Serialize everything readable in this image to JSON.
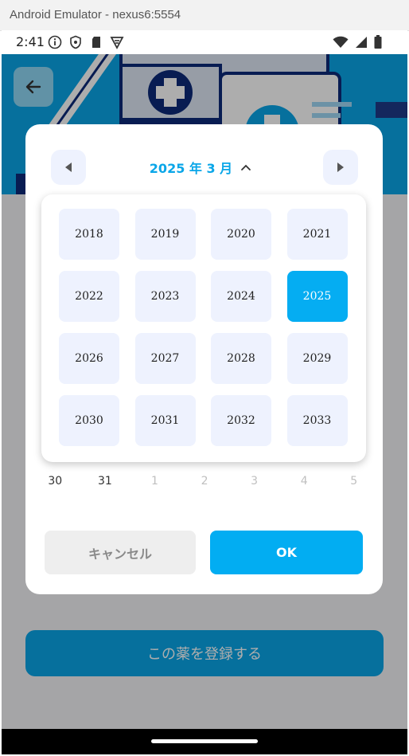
{
  "window": {
    "title": "Android Emulator - nexus6:5554"
  },
  "statusbar": {
    "time": "2:41",
    "left_icons": [
      "info-icon",
      "shield-icon",
      "sd-card-icon",
      "vpn-icon"
    ],
    "right_icons": [
      "wifi-icon",
      "signal-icon",
      "battery-icon"
    ]
  },
  "dialog": {
    "month_label": "2025 年 3 月",
    "years": [
      "2018",
      "2019",
      "2020",
      "2021",
      "2022",
      "2023",
      "2024",
      "2025",
      "2026",
      "2027",
      "2028",
      "2029",
      "2030",
      "2031",
      "2032",
      "2033"
    ],
    "selected_year": "2025",
    "day_row": [
      {
        "day": "30",
        "muted": false
      },
      {
        "day": "31",
        "muted": false
      },
      {
        "day": "1",
        "muted": true
      },
      {
        "day": "2",
        "muted": true
      },
      {
        "day": "3",
        "muted": true
      },
      {
        "day": "4",
        "muted": true
      },
      {
        "day": "5",
        "muted": true
      }
    ],
    "cancel_label": "キャンセル",
    "ok_label": "OK"
  },
  "page": {
    "register_button": "この薬を登録する"
  },
  "colors": {
    "accent": "#02adf2",
    "year_cell": "#eef2fe",
    "banner": "#0aa6e8"
  }
}
